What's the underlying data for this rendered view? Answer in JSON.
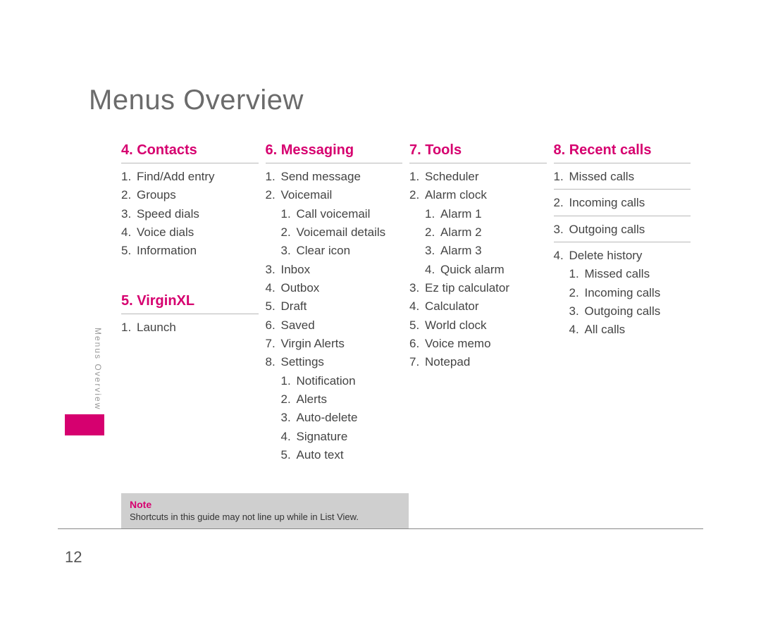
{
  "page_title": "Menus Overview",
  "sidebar_label": "Menus Overview",
  "page_number": "12",
  "note": {
    "label": "Note",
    "text": "Shortcuts in this guide may not line up while in List View."
  },
  "col1": {
    "s1": {
      "title": "4. Contacts",
      "i1": "Find/Add entry",
      "i2": "Groups",
      "i3": "Speed dials",
      "i4": "Voice dials",
      "i5": "Information"
    },
    "s2": {
      "title": "5. VirginXL",
      "i1": "Launch"
    }
  },
  "col2": {
    "s1": {
      "title": "6. Messaging",
      "i1": "Send message",
      "i2": "Voicemail",
      "i2_1": "Call voicemail",
      "i2_2": "Voicemail details",
      "i2_3": "Clear icon",
      "i3": "Inbox",
      "i4": "Outbox",
      "i5": "Draft",
      "i6": "Saved",
      "i7": "Virgin Alerts",
      "i8": "Settings",
      "i8_1": "Notification",
      "i8_2": "Alerts",
      "i8_3": "Auto-delete",
      "i8_4": "Signature",
      "i8_5": "Auto text"
    }
  },
  "col3": {
    "s1": {
      "title": "7. Tools",
      "i1": "Scheduler",
      "i2": "Alarm clock",
      "i2_1": "Alarm 1",
      "i2_2": "Alarm 2",
      "i2_3": "Alarm 3",
      "i2_4": "Quick alarm",
      "i3": "Ez tip calculator",
      "i4": "Calculator",
      "i5": "World clock",
      "i6": "Voice memo",
      "i7": "Notepad"
    }
  },
  "col4": {
    "s1": {
      "title": "8. Recent calls",
      "i1": "Missed calls",
      "i2": "Incoming calls",
      "i3": "Outgoing calls",
      "i4": "Delete history",
      "i4_1": "Missed calls",
      "i4_2": "Incoming calls",
      "i4_3": "Outgoing calls",
      "i4_4": "All calls"
    }
  }
}
